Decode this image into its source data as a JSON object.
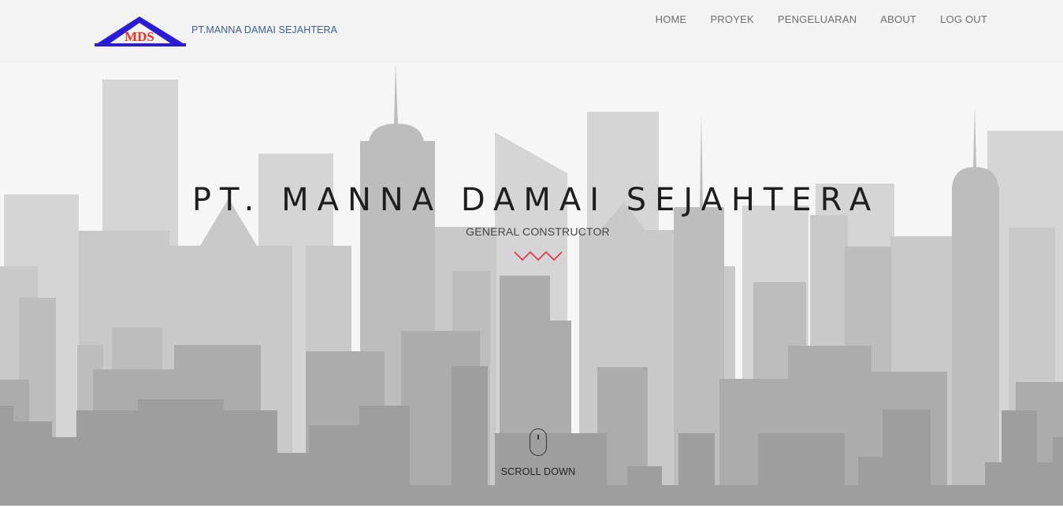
{
  "brand": {
    "logo_text": "MDS",
    "name": "PT.MANNA DAMAI SEJAHTERA"
  },
  "nav": {
    "items": [
      {
        "label": "HOME"
      },
      {
        "label": "PROYEK"
      },
      {
        "label": "PENGELUARAN"
      },
      {
        "label": "ABOUT"
      },
      {
        "label": "LOG OUT"
      }
    ]
  },
  "hero": {
    "title": "PT. MANNA DAMAI SEJAHTERA",
    "subtitle": "GENERAL CONSTRUCTOR",
    "scroll_label": "SCROLL DOWN"
  },
  "icons": {
    "logo": "house-roof-logo",
    "divider": "zigzag-divider-icon",
    "scroll": "mouse-icon"
  },
  "colors": {
    "logo_roof": "#2a1bd8",
    "logo_text": "#ff2a1a",
    "brand_text": "#3f5f8f",
    "accent_zigzag": "#e23a4a",
    "navbar_bg": "#f3f3f3"
  }
}
